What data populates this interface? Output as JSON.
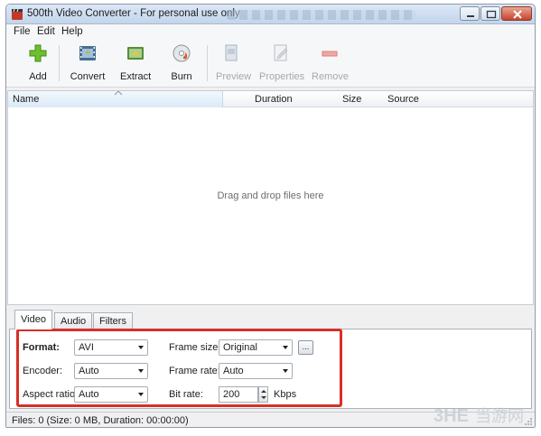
{
  "window": {
    "title": "500th Video Converter - For personal use only"
  },
  "menu": [
    "File",
    "Edit",
    "Help"
  ],
  "toolbar": {
    "add": "Add",
    "convert": "Convert",
    "extract": "Extract",
    "burn": "Burn",
    "preview": "Preview",
    "properties": "Properties",
    "remove": "Remove"
  },
  "file_list": {
    "columns": [
      "Name",
      "Duration",
      "Size",
      "Source"
    ],
    "empty_hint": "Drag and drop files here"
  },
  "tabs": [
    "Video",
    "Audio",
    "Filters"
  ],
  "video_settings": {
    "format_label": "Format:",
    "format_value": "AVI",
    "encoder_label": "Encoder:",
    "encoder_value": "Auto",
    "aspect_label": "Aspect ratio:",
    "aspect_value": "Auto",
    "frame_size_label": "Frame size:",
    "frame_size_value": "Original",
    "frame_size_more": "...",
    "frame_rate_label": "Frame rate:",
    "frame_rate_value": "Auto",
    "bit_rate_label": "Bit rate:",
    "bit_rate_value": "200",
    "bit_rate_unit": "Kbps"
  },
  "status": {
    "text": "Files: 0 (Size: 0 MB, Duration: 00:00:00)"
  },
  "watermark": {
    "text": "3HE当游网"
  },
  "colors": {
    "highlight": "#d63027",
    "add_icon": "#6fbf2e",
    "title_gradient_top": "#dbe7f6"
  }
}
